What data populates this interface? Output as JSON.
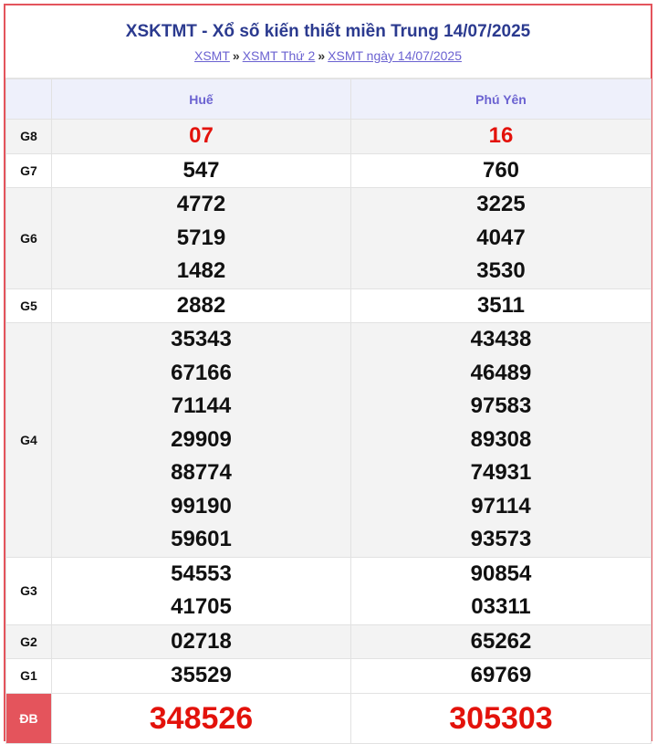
{
  "header": {
    "title": "XSKTMT - Xổ số kiến thiết miền Trung 14/07/2025",
    "breadcrumbs": [
      "XSMT",
      "XSMT Thứ 2",
      "XSMT ngày 14/07/2025"
    ],
    "separator": "»"
  },
  "provinces": [
    "Huế",
    "Phú Yên"
  ],
  "prizes": [
    {
      "label": "G8",
      "hue": [
        "07"
      ],
      "phuyen": [
        "16"
      ]
    },
    {
      "label": "G7",
      "hue": [
        "547"
      ],
      "phuyen": [
        "760"
      ]
    },
    {
      "label": "G6",
      "hue": [
        "4772",
        "5719",
        "1482"
      ],
      "phuyen": [
        "3225",
        "4047",
        "3530"
      ]
    },
    {
      "label": "G5",
      "hue": [
        "2882"
      ],
      "phuyen": [
        "3511"
      ]
    },
    {
      "label": "G4",
      "hue": [
        "35343",
        "67166",
        "71144",
        "29909",
        "88774",
        "99190",
        "59601"
      ],
      "phuyen": [
        "43438",
        "46489",
        "97583",
        "89308",
        "74931",
        "97114",
        "93573"
      ]
    },
    {
      "label": "G3",
      "hue": [
        "54553",
        "41705"
      ],
      "phuyen": [
        "90854",
        "03311"
      ]
    },
    {
      "label": "G2",
      "hue": [
        "02718"
      ],
      "phuyen": [
        "65262"
      ]
    },
    {
      "label": "G1",
      "hue": [
        "35529"
      ],
      "phuyen": [
        "69769"
      ]
    },
    {
      "label": "ĐB",
      "hue": [
        "348526"
      ],
      "phuyen": [
        "305303"
      ]
    }
  ],
  "colors": {
    "accent": "#e4545c",
    "title": "#2b3a8f",
    "link": "#6b62d1",
    "special": "#e3120b"
  }
}
